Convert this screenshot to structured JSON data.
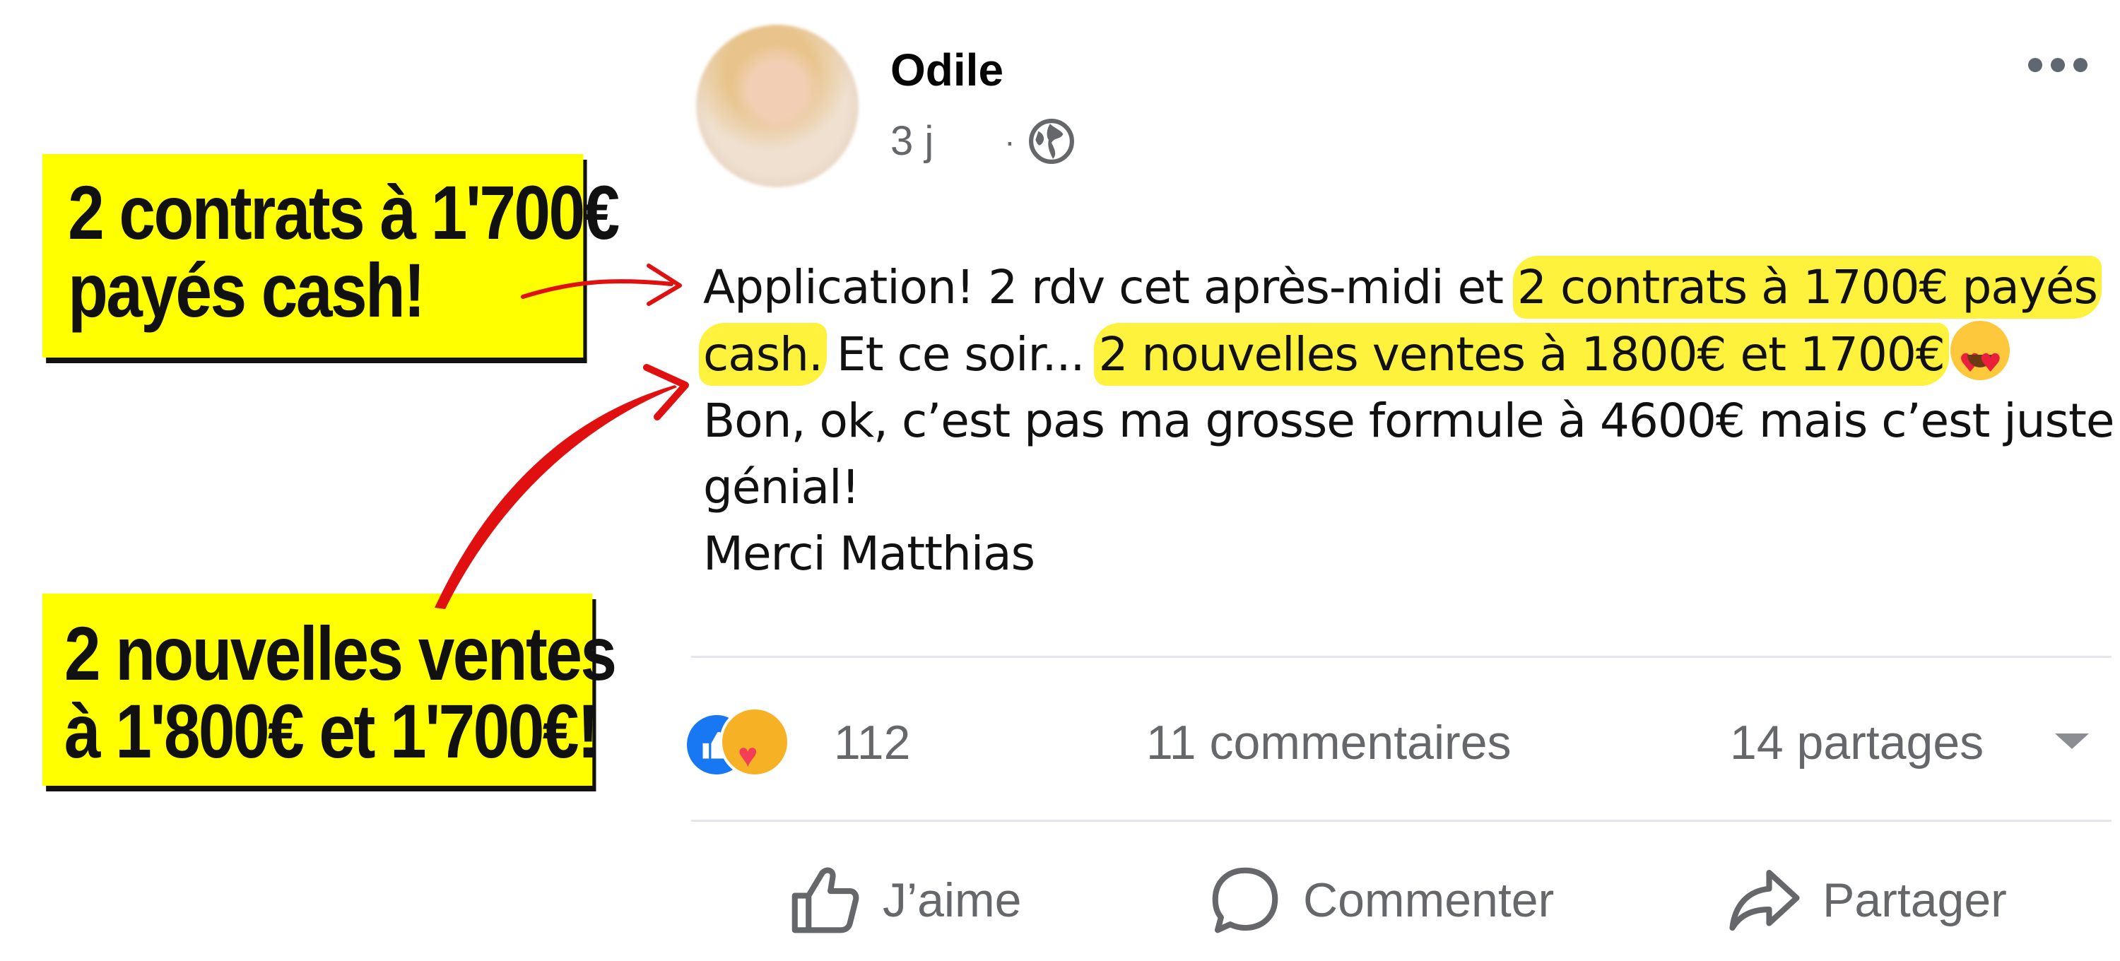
{
  "callouts": {
    "first": {
      "line1": "2 contrats à 1'700€",
      "line2": "payés cash!"
    },
    "second": {
      "line1": "2 nouvelles ventes",
      "line2": "à 1'800€ et 1'700€!"
    }
  },
  "post": {
    "author": "Odile",
    "time": "3 j",
    "separator": "·",
    "privacy_icon": "globe-icon",
    "text": {
      "l1_plain": "Application! 2 rdv cet après-midi et ",
      "l1_hl": "2 contrats à 1700€ payés",
      "l2_hl": "cash.",
      "l2_plain": " Et ce soir... ",
      "l2_hl2": "2 nouvelles ventes à 1800€ et 1700€",
      "l2_emoji": "heart-eyes-emoji",
      "l3": "Bon, ok, c’est pas ma grosse formule à 4600€ mais c’est juste",
      "l4": "génial!",
      "l5": "Merci Matthias"
    }
  },
  "stats": {
    "reaction_icons": [
      "like-icon",
      "care-icon"
    ],
    "reactions_count": "112",
    "comments": "11 commentaires",
    "shares": "14 partages"
  },
  "actions": {
    "like": "J’aime",
    "comment": "Commenter",
    "share": "Partager"
  },
  "colors": {
    "highlight": "#fff23c",
    "callout": "#ffff00",
    "arrow": "#e01010",
    "facebook_blue": "#1877f2",
    "muted_text": "#65676b"
  }
}
